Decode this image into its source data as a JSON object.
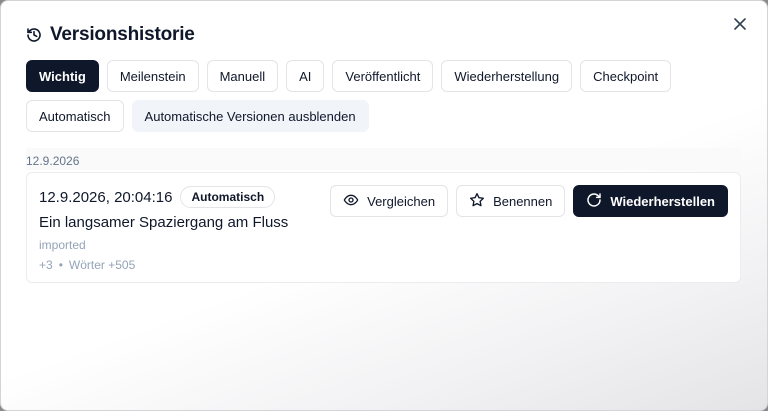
{
  "dialog": {
    "title": "Versionshistorie",
    "title_icon": "history-icon",
    "close_icon": "close-icon"
  },
  "filters": [
    {
      "label": "Wichtig",
      "active": true
    },
    {
      "label": "Meilenstein",
      "active": false
    },
    {
      "label": "Manuell",
      "active": false
    },
    {
      "label": "AI",
      "active": false
    },
    {
      "label": "Veröffentlicht",
      "active": false
    },
    {
      "label": "Wiederherstellung",
      "active": false
    },
    {
      "label": "Checkpoint",
      "active": false
    },
    {
      "label": "Automatisch",
      "active": false
    }
  ],
  "hide_auto_label": "Automatische Versionen ausblenden",
  "groups": [
    {
      "date": "12.9.2026",
      "versions": [
        {
          "timestamp": "12.9.2026, 20:04:16",
          "badge": "Automatisch",
          "title": "Ein langsamer Spaziergang am Fluss",
          "note": "imported",
          "change": "+3",
          "words": "Wörter +505",
          "actions": {
            "compare": {
              "label": "Vergleichen",
              "icon": "eye-icon"
            },
            "rename": {
              "label": "Benennen",
              "icon": "star-icon"
            },
            "restore": {
              "label": "Wiederherstellen",
              "icon": "restore-icon"
            }
          }
        }
      ]
    }
  ],
  "colors": {
    "primary": "#0f172a",
    "muted_text": "#94a3b8",
    "border": "#e4e4e7"
  }
}
